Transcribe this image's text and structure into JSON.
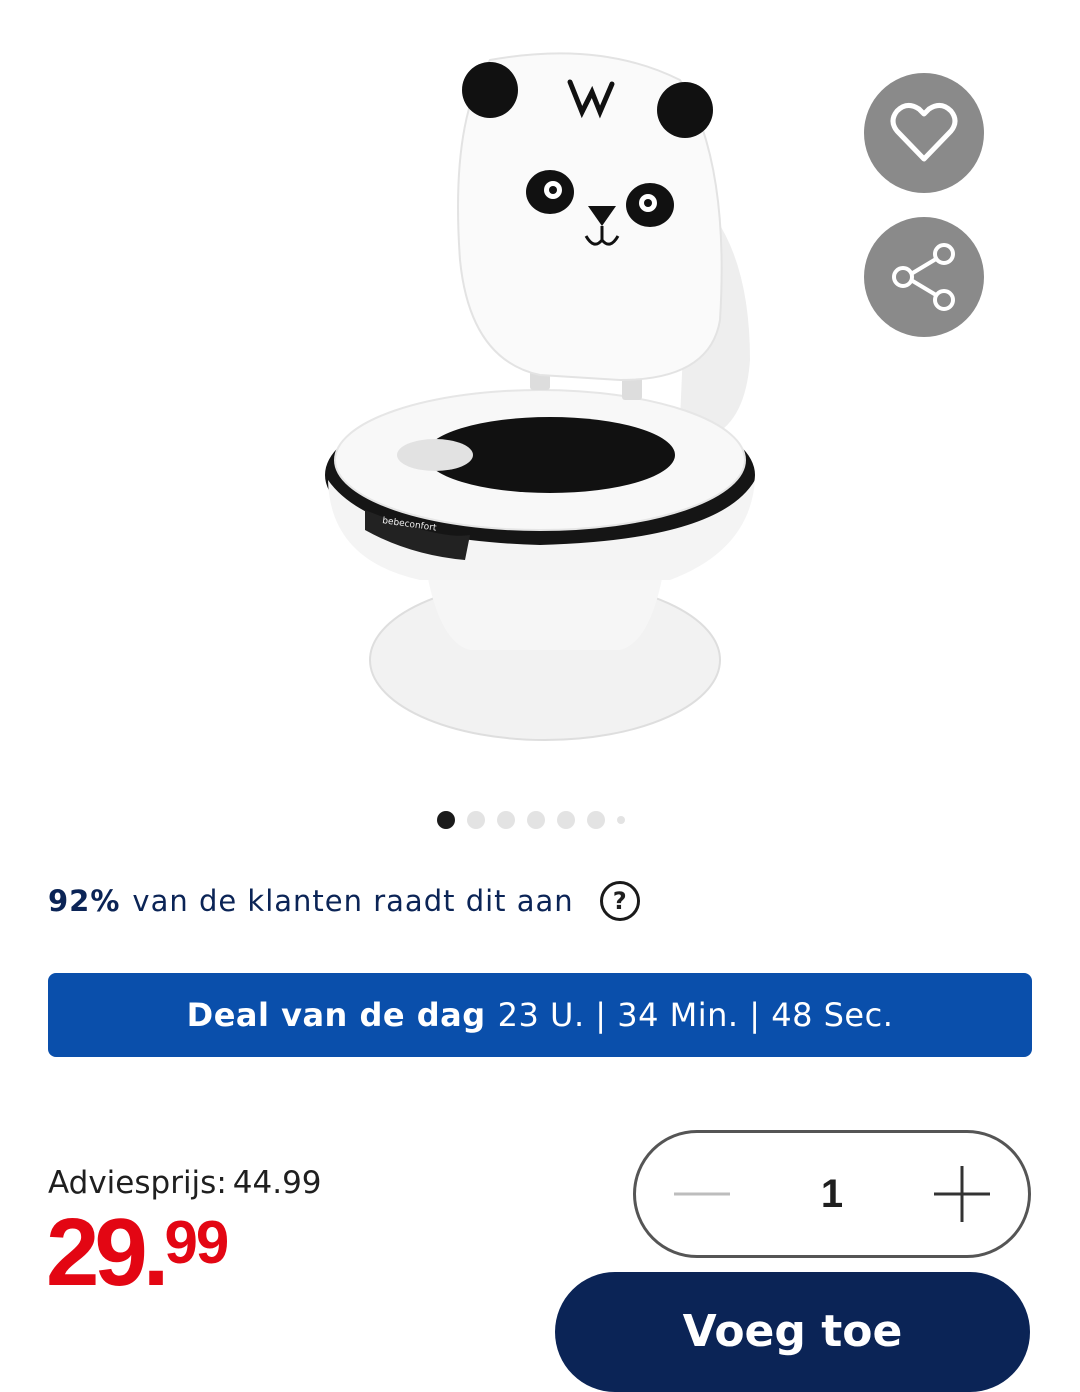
{
  "product": {
    "image_alt": "panda potty toilet",
    "brand_on_image": "bebeconfort"
  },
  "actions": {
    "favorite_icon": "heart-icon",
    "share_icon": "share-icon"
  },
  "gallery": {
    "total_dots": 7,
    "active_index": 0
  },
  "rating": {
    "percent": "92%",
    "text": "van de klanten raadt dit aan",
    "help": "?"
  },
  "deal": {
    "label": "Deal van de dag",
    "timer": "23 U. | 34 Min. | 48 Sec."
  },
  "pricing": {
    "advies_label": "Adviesprijs:",
    "advies_value": "44.99",
    "price_main": "29.",
    "price_decimals": "99",
    "price_color": "#e30613"
  },
  "quantity": {
    "value": "1"
  },
  "cart": {
    "label": "Voeg toe"
  },
  "colors": {
    "deal_bg": "#0a4fab",
    "navy": "#0b2456",
    "fab_bg": "#8a8a8a"
  }
}
